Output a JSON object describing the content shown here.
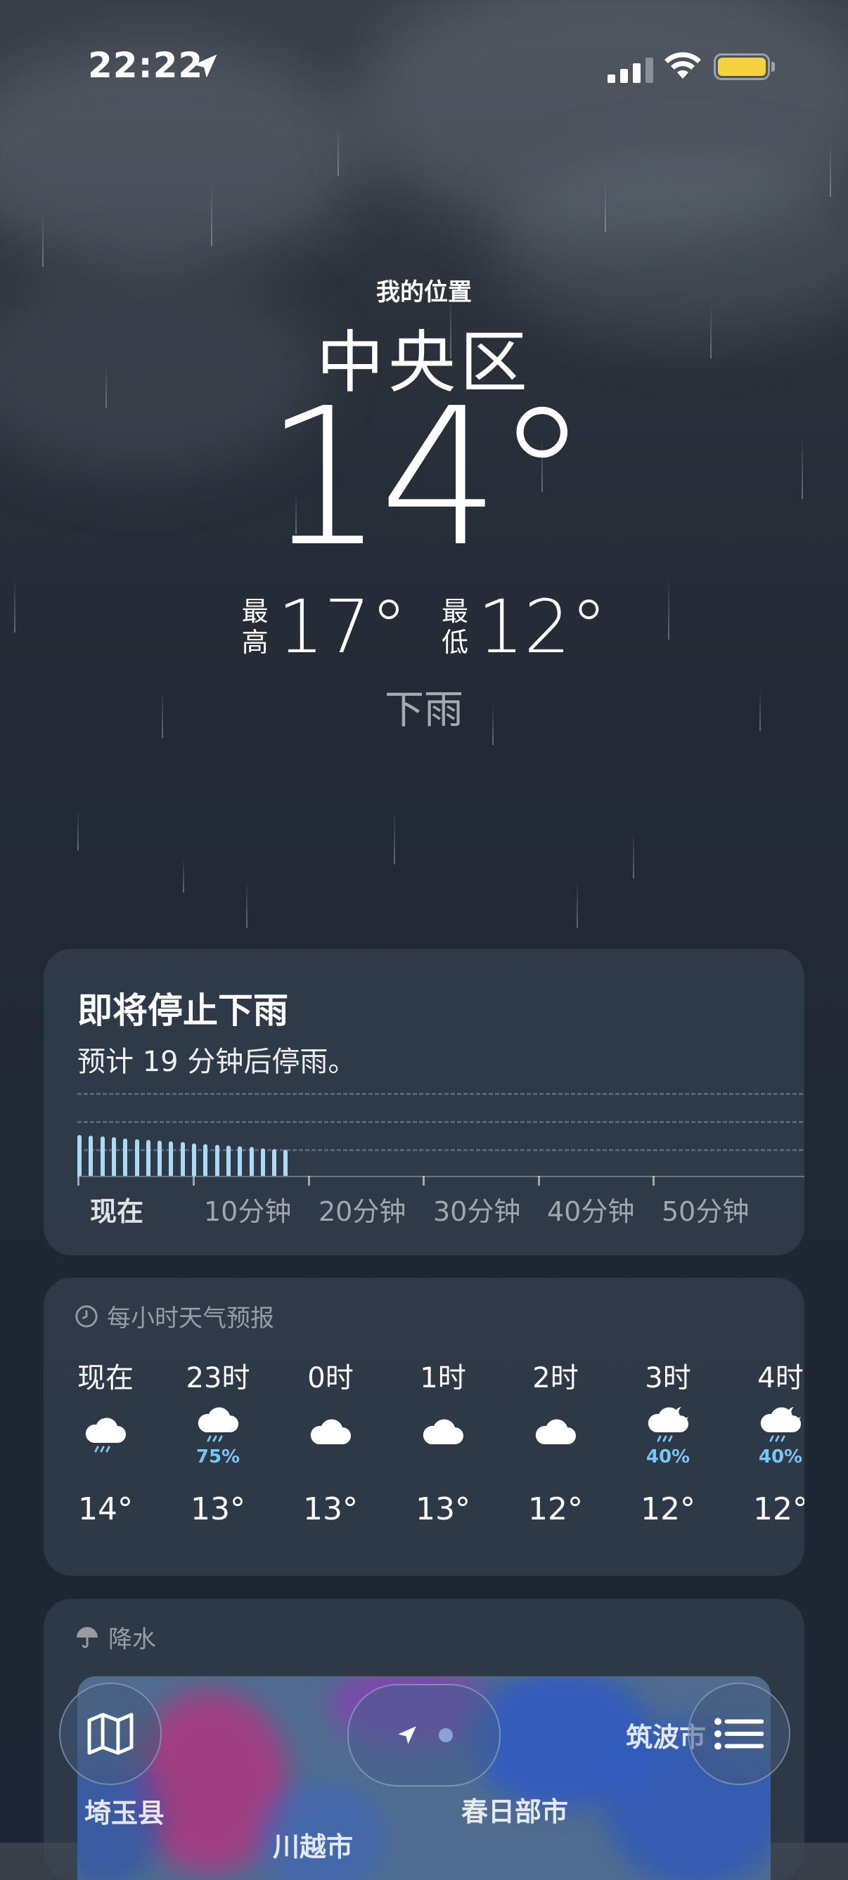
{
  "status_bar": {
    "time": "22:22"
  },
  "header": {
    "my_location": "我的位置",
    "city": "中央区",
    "temperature": "14°",
    "high_label": "最高",
    "high": "17°",
    "low_label": "最低",
    "low": "12°",
    "condition": "下雨"
  },
  "precip_card": {
    "title": "即将停止下雨",
    "subtitle": "预计 19 分钟后停雨。",
    "time_labels": [
      "现在",
      "10分钟",
      "20分钟",
      "30分钟",
      "40分钟",
      "50分钟"
    ]
  },
  "hourly": {
    "header": "每小时天气预报",
    "icon_header": "clock-icon",
    "items": [
      {
        "time": "现在",
        "icon": "rain-cloud-icon",
        "pop": "",
        "temp": "14°"
      },
      {
        "time": "23时",
        "icon": "rain-cloud-icon",
        "pop": "75%",
        "temp": "13°"
      },
      {
        "time": "0时",
        "icon": "cloud-icon",
        "pop": "",
        "temp": "13°"
      },
      {
        "time": "1时",
        "icon": "cloud-icon",
        "pop": "",
        "temp": "13°"
      },
      {
        "time": "2时",
        "icon": "cloud-icon",
        "pop": "",
        "temp": "12°"
      },
      {
        "time": "3时",
        "icon": "moon-rain-cloud-icon",
        "pop": "40%",
        "temp": "12°"
      },
      {
        "time": "4时",
        "icon": "moon-rain-cloud-icon",
        "pop": "40%",
        "temp": "12°"
      }
    ]
  },
  "rain_map": {
    "header": "降水",
    "labels": [
      "埼玉县",
      "川越市",
      "春日部市",
      "筑波市"
    ]
  },
  "colors": {
    "bar": "#a9dbf6",
    "pop": "#79c6f3",
    "battery": "#f5d23e"
  }
}
